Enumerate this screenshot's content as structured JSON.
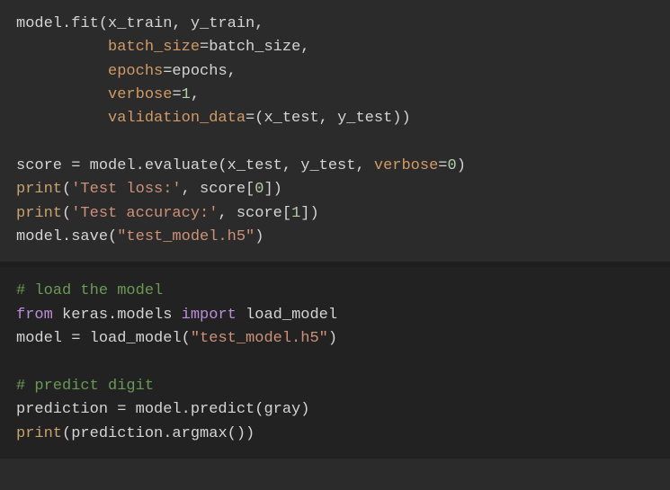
{
  "block1": {
    "l1": "model.fit(x_train, y_train,",
    "l2": "          batch_size",
    "l2b": "=batch_size,",
    "l3": "          epochs",
    "l3b": "=epochs,",
    "l4": "          verbose",
    "l4b": "=",
    "l4n": "1",
    "l4c": ",",
    "l5": "          validation_data",
    "l5b": "=(x_test, y_test))",
    "l6": "",
    "l7a": "score = model.evaluate(x_test, y_test, ",
    "l7p": "verbose",
    "l7e": "=",
    "l7n": "0",
    "l7c": ")",
    "l8a": "print",
    "l8b": "(",
    "l8s": "'Test loss:'",
    "l8c": ", score[",
    "l8n": "0",
    "l8d": "])",
    "l9a": "print",
    "l9b": "(",
    "l9s": "'Test accuracy:'",
    "l9c": ", score[",
    "l9n": "1",
    "l9d": "])",
    "l10a": "model.save(",
    "l10s": "\"test_model.h5\"",
    "l10b": ")"
  },
  "block2": {
    "c1": "# load the model",
    "l1a": "from",
    "l1b": " keras.models ",
    "l1c": "import",
    "l1d": " load_model",
    "l2a": "model = load_model(",
    "l2s": "\"test_model.h5\"",
    "l2b": ")",
    "c2": "# predict digit",
    "l3": "prediction = model.predict(gray)",
    "l4a": "print",
    "l4b": "(prediction.argmax())"
  }
}
